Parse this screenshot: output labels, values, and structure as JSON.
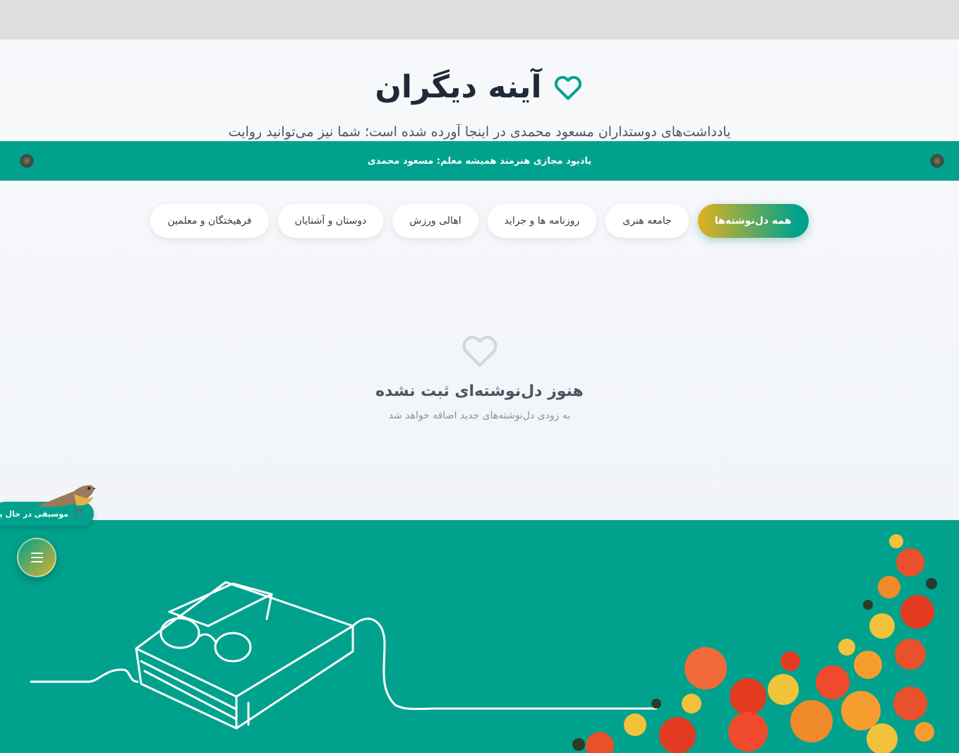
{
  "hero": {
    "title": "آینه دیگران",
    "subtitle": "یادداشت‌های دوستداران مسعود محمدی در اینجا آورده شده است؛ شما نیز می‌توانید روایت"
  },
  "banner": {
    "text": "یادبود مجازی هنرمند همیشه معلم: مسعود محمدی"
  },
  "tabs": [
    {
      "label": "همه دل‌نوشته‌ها",
      "active": true
    },
    {
      "label": "جامعه هنری",
      "active": false
    },
    {
      "label": "روزنامه ها و جراید",
      "active": false
    },
    {
      "label": "اهالی ورزش",
      "active": false
    },
    {
      "label": "دوستان و آشنایان",
      "active": false
    },
    {
      "label": "فرهیختگان و معلمین",
      "active": false
    }
  ],
  "empty_state": {
    "title": "هنوز دل‌نوشته‌ای ثبت نشده",
    "subtitle": "به زودی دل‌نوشته‌های جدید اضافه خواهد شد"
  },
  "music": {
    "label": "موسیقی در حال پخش"
  },
  "colors": {
    "accent": "#00a28d",
    "gold": "#e0b020",
    "title": "#1f2937"
  },
  "icons": [
    "heart-icon",
    "music-note-icon",
    "hamburger-menu-icon",
    "ornament-icon",
    "bird-icon"
  ]
}
